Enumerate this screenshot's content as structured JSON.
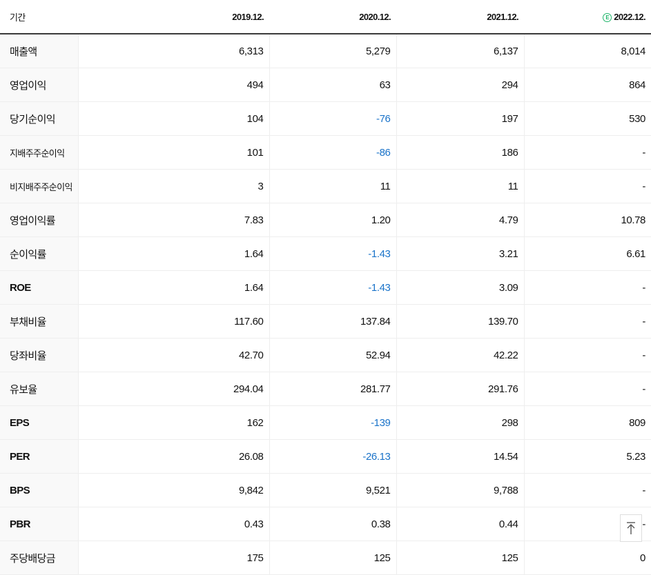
{
  "header": {
    "label": "기간",
    "years": [
      "2019.12.",
      "2020.12.",
      "2021.12.",
      "2022.12."
    ],
    "estimate_mark": "E"
  },
  "rows": [
    {
      "label": "매출액",
      "values": [
        "6,313",
        "5,279",
        "6,137",
        "8,014"
      ]
    },
    {
      "label": "영업이익",
      "values": [
        "494",
        "63",
        "294",
        "864"
      ]
    },
    {
      "label": "당기순이익",
      "values": [
        "104",
        "-76",
        "197",
        "530"
      ]
    },
    {
      "label": "지배주주순이익",
      "values": [
        "101",
        "-86",
        "186",
        "-"
      ]
    },
    {
      "label": "비지배주주순이익",
      "values": [
        "3",
        "11",
        "11",
        "-"
      ]
    },
    {
      "label": "영업이익률",
      "values": [
        "7.83",
        "1.20",
        "4.79",
        "10.78"
      ]
    },
    {
      "label": "순이익률",
      "values": [
        "1.64",
        "-1.43",
        "3.21",
        "6.61"
      ]
    },
    {
      "label": "ROE",
      "values": [
        "1.64",
        "-1.43",
        "3.09",
        "-"
      ]
    },
    {
      "label": "부채비율",
      "values": [
        "117.60",
        "137.84",
        "139.70",
        "-"
      ]
    },
    {
      "label": "당좌비율",
      "values": [
        "42.70",
        "52.94",
        "42.22",
        "-"
      ]
    },
    {
      "label": "유보율",
      "values": [
        "294.04",
        "281.77",
        "291.76",
        "-"
      ]
    },
    {
      "label": "EPS",
      "values": [
        "162",
        "-139",
        "298",
        "809"
      ]
    },
    {
      "label": "PER",
      "values": [
        "26.08",
        "-26.13",
        "14.54",
        "5.23"
      ]
    },
    {
      "label": "BPS",
      "values": [
        "9,842",
        "9,521",
        "9,788",
        "-"
      ]
    },
    {
      "label": "PBR",
      "values": [
        "0.43",
        "0.38",
        "0.44",
        "-"
      ]
    },
    {
      "label": "주당배당금",
      "values": [
        "175",
        "125",
        "125",
        "0"
      ]
    }
  ],
  "top_button": {
    "icon": "arrow-up-icon"
  },
  "colors": {
    "negative": "#1a73c9",
    "estimate": "#1fb56a"
  }
}
